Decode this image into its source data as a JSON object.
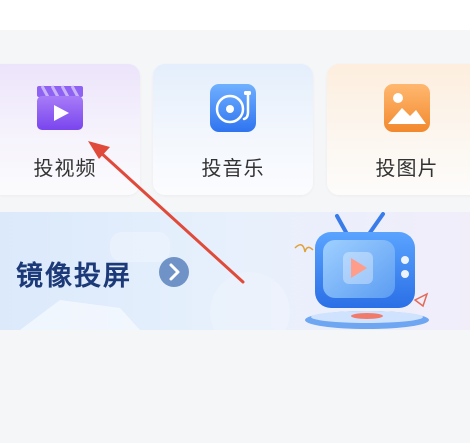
{
  "cast_options": [
    {
      "label": "投视频",
      "icon": "video-clapper-icon"
    },
    {
      "label": "投音乐",
      "icon": "music-record-icon"
    },
    {
      "label": "投图片",
      "icon": "picture-icon"
    }
  ],
  "banner": {
    "title": "镜像投屏",
    "icon": "chevron-right-icon",
    "illustration": "tv-play-icon"
  },
  "annotation": {
    "type": "red-arrow",
    "points_to": "投视频"
  },
  "colors": {
    "video_accent": "#8b5cf6",
    "music_accent": "#3b82f6",
    "photo_accent": "#f59e42",
    "banner_title": "#1d3a78",
    "arrow_red": "#e04a3a"
  }
}
